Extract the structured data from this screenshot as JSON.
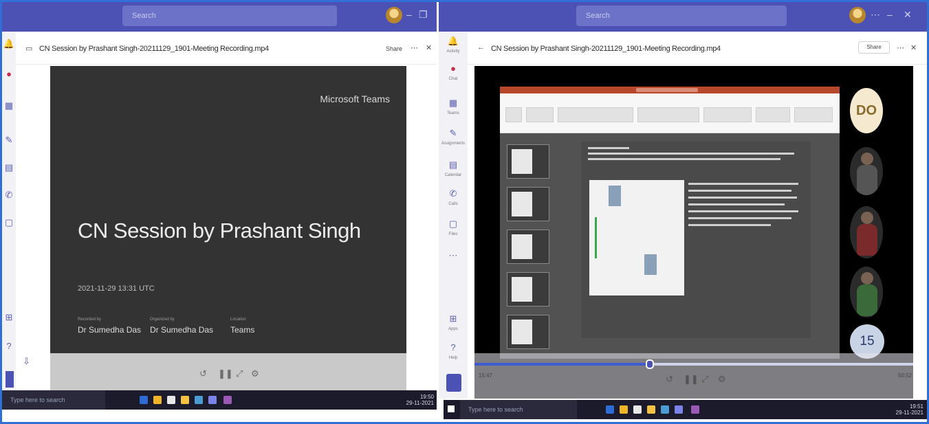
{
  "left_window": {
    "search_placeholder": "Search",
    "file_name": "CN Session by Prashant Singh-20211129_1901-Meeting Recording.mp4",
    "share_label": "Share",
    "slide": {
      "brand": "Microsoft Teams",
      "title": "CN Session by Prashant Singh",
      "date": "2021-11-29 13:31 UTC",
      "meta": [
        {
          "label": "Recorded by",
          "value": "Dr Sumedha Das"
        },
        {
          "label": "Organized by",
          "value": "Dr Sumedha Das"
        },
        {
          "label": "Location",
          "value": "Teams"
        }
      ]
    },
    "rail_labels": [
      "Activity",
      "Chat",
      "Teams",
      "Assignments",
      "Calendar",
      "Calls",
      "Files",
      "Apps",
      "Help"
    ],
    "taskbar": {
      "search": "Type here to search",
      "time": "19:50",
      "date": "29-11-2021"
    }
  },
  "right_window": {
    "search_placeholder": "Search",
    "file_name": "CN Session by Prashant Singh-20211129_1901-Meeting Recording.mp4",
    "share_label": "Share",
    "avatar_initials": "DO",
    "participant_count": "15",
    "progress_fraction": 0.4,
    "elapsed": "15:47",
    "duration": "50:52",
    "rail_labels": [
      "Activity",
      "Chat",
      "Teams",
      "Assignments",
      "Calendar",
      "Calls",
      "Files",
      "Apps",
      "Help"
    ],
    "taskbar": {
      "search": "Type here to search",
      "time": "19:51",
      "date": "29-11-2021"
    }
  },
  "colors": {
    "teams_purple": "#4b52b4",
    "accent_blue": "#3d5ccf",
    "ppt_red": "#b7472a"
  }
}
